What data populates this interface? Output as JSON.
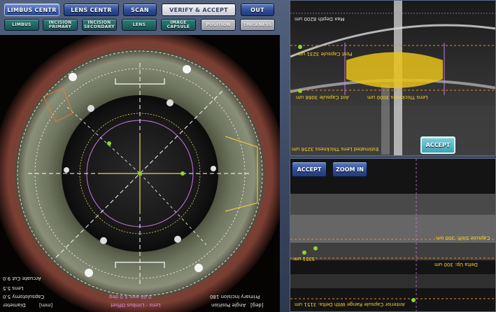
{
  "toolbar": {
    "buttons": [
      {
        "label": "LIMBUS CENTR",
        "state": "active"
      },
      {
        "label": "LENS CENTR",
        "state": "normal"
      },
      {
        "label": "SCAN",
        "state": "normal"
      },
      {
        "label": "VERIFY & ACCEPT",
        "state": "light"
      },
      {
        "label": "OUT",
        "state": "normal"
      }
    ]
  },
  "steps": [
    {
      "line1": "LIMBUS",
      "line2": "",
      "state": "active"
    },
    {
      "line1": "INCISION",
      "line2": "PRIMARY",
      "state": "active"
    },
    {
      "line1": "INCISION",
      "line2": "SECONDARY",
      "state": "active"
    },
    {
      "line1": "LENS",
      "line2": "",
      "state": "active"
    },
    {
      "line1": "IMAGE",
      "line2": "CAPSULE",
      "state": "active"
    },
    {
      "line1": "POSITION",
      "line2": "",
      "state": "dim"
    },
    {
      "line1": "THICKNESS",
      "line2": "",
      "state": "dim"
    }
  ],
  "eye_readouts": {
    "diameter_label": "Diameter",
    "diameter_unit": "[mm]",
    "capsulotomy": "Capsulotomy 5.0",
    "lens": "Lens 5.5",
    "arcuate_cut": "Arcuate Cut 9.0",
    "angle_position_label": "Angle Position",
    "angle_unit": "[deg]",
    "primary_incision": "Primary Incision 180",
    "offset_label": "Lens - Limbus Offset",
    "offset_value": "0.00 mm X 0 deg"
  },
  "oct_top": {
    "max_depth": "Max Depth 8200 um",
    "post_capsule": "Post Capsule 3231 um",
    "ant_capsule": "Ant Capsule 3066 um",
    "lens_thickness_short": "Lens Thickness 3000 um",
    "estimated_thickness": "Estimated Lens Thickness 3256 um",
    "accept_label": "ACCEPT"
  },
  "oct_bottom": {
    "accept_label": "ACCEPT",
    "zoom_label": "ZOOM IN",
    "depth_left": "3351 um",
    "capsule_shift": "Capsule Shift: 300 um",
    "delta_up": "Delta Up: 300 um",
    "anterior_capsule_range": "Anterior Capsule Range With Delta: 3151 um"
  },
  "colors": {
    "accent_yellow": "#ffd21e",
    "marker_green": "#8fd42d",
    "magenta": "#e08ef0",
    "button_blue": "#2e4c95",
    "step_teal": "#16514d"
  }
}
